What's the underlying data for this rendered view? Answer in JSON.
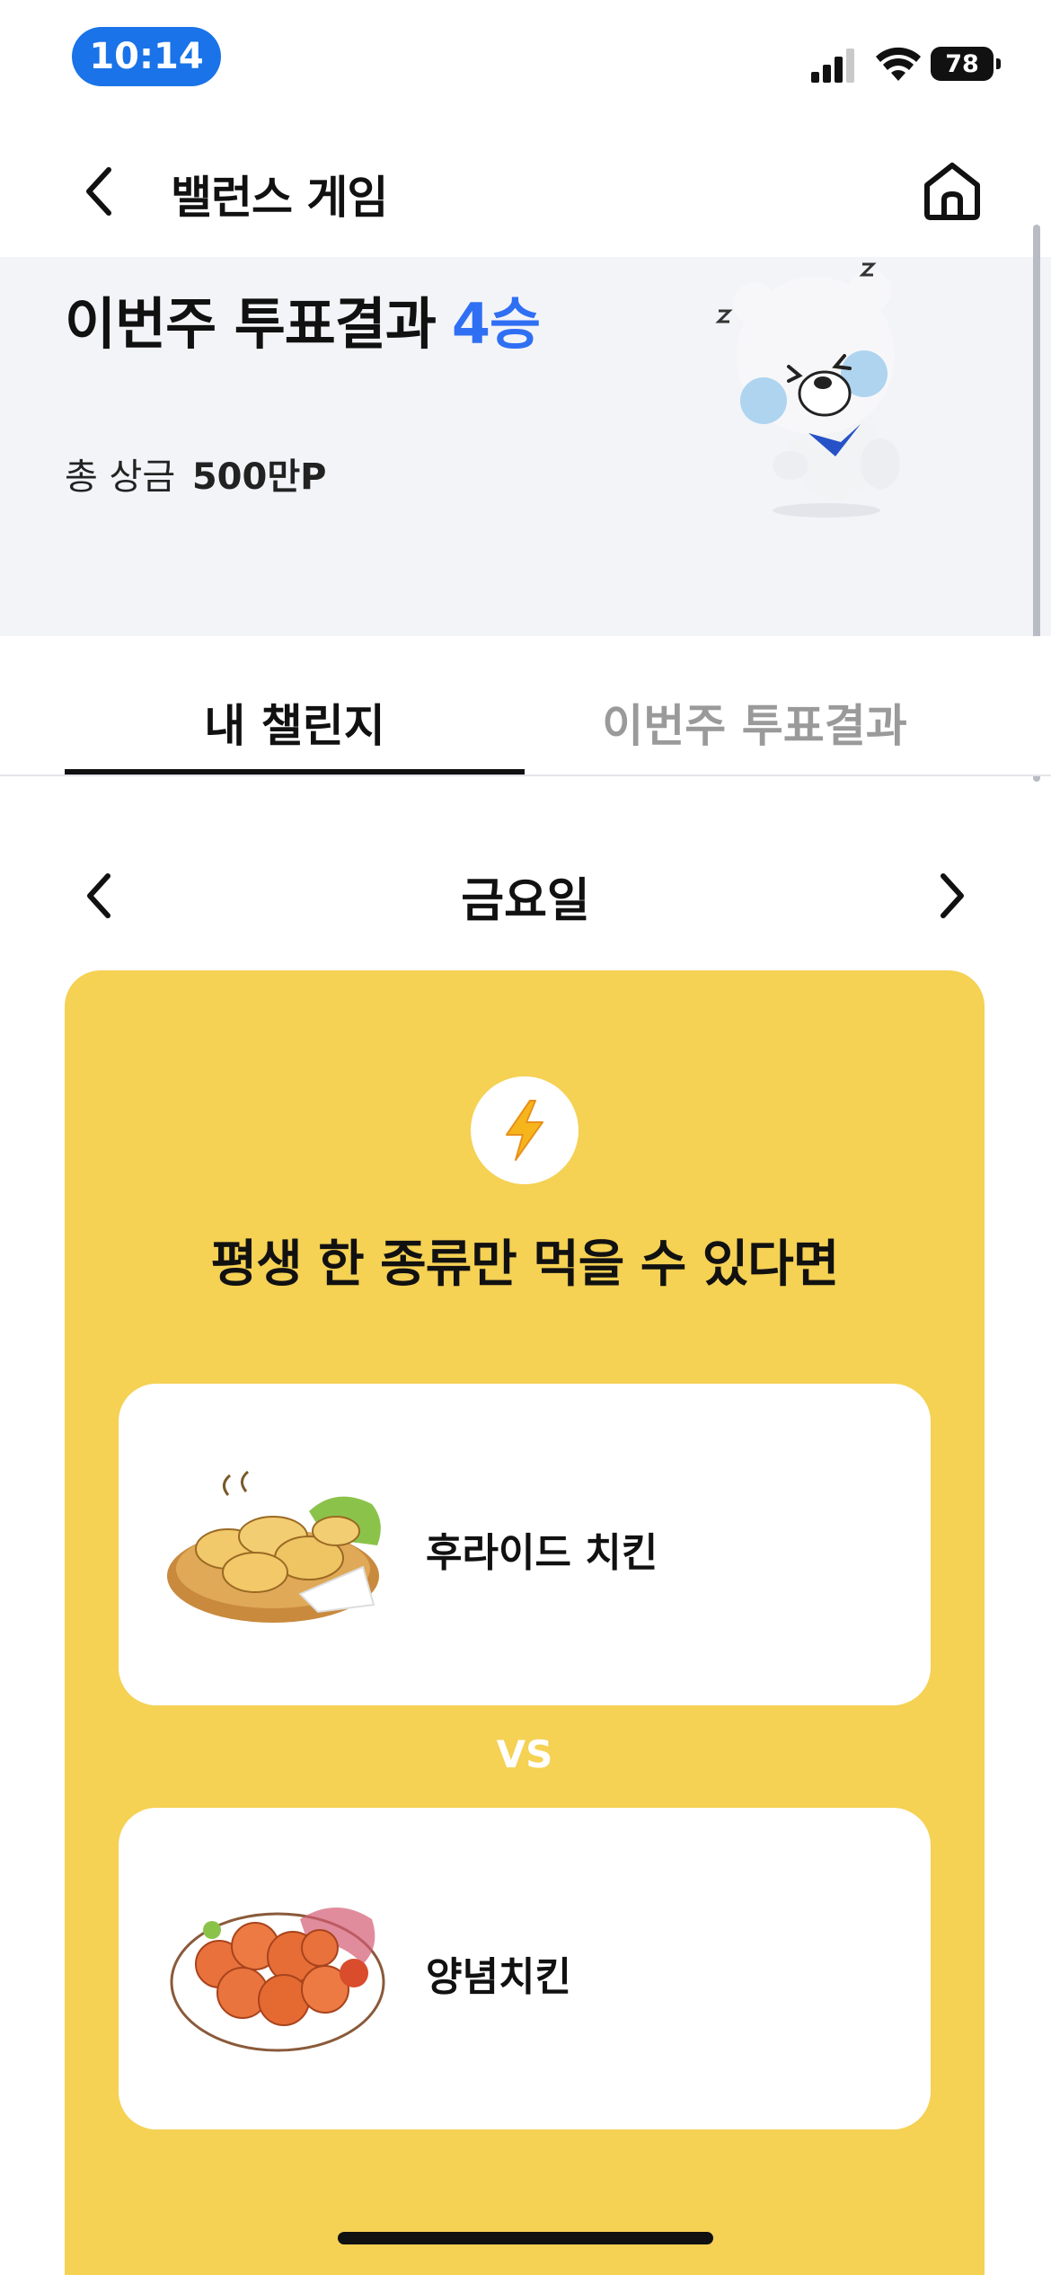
{
  "status_bar": {
    "time": "10:14",
    "battery": "78",
    "icons": [
      "cellular-signal-icon",
      "wifi-icon",
      "battery-icon"
    ]
  },
  "header": {
    "title": "밸런스 게임",
    "back_icon": "chevron-left-icon",
    "home_icon": "home-icon"
  },
  "banner": {
    "title": "이번주 투표결과",
    "wins": "4승",
    "prize_label": "총 상금",
    "prize_amount": "500만P",
    "mascot": "polar-bear-mascot"
  },
  "tabs": [
    {
      "label": "내 챌린지",
      "active": true
    },
    {
      "label": "이번주 투표결과",
      "active": false
    }
  ],
  "day_nav": {
    "day": "금요일",
    "prev_icon": "chevron-left-icon",
    "next_icon": "chevron-right-icon"
  },
  "challenge": {
    "icon": "lightning-bolt-icon",
    "question": "평생 한 종류만 먹을 수 있다면",
    "options": [
      {
        "label": "후라이드 치킨",
        "image": "fried-chicken-illustration"
      },
      {
        "label": "양념치킨",
        "image": "seasoned-chicken-illustration"
      }
    ],
    "vs_label": "VS"
  },
  "colors": {
    "accent_blue": "#2f6ff3",
    "card_yellow": "#f5d154",
    "banner_bg": "#f3f4f8",
    "inactive_tab": "#9a9a9a",
    "time_pill": "#1a73e8"
  }
}
